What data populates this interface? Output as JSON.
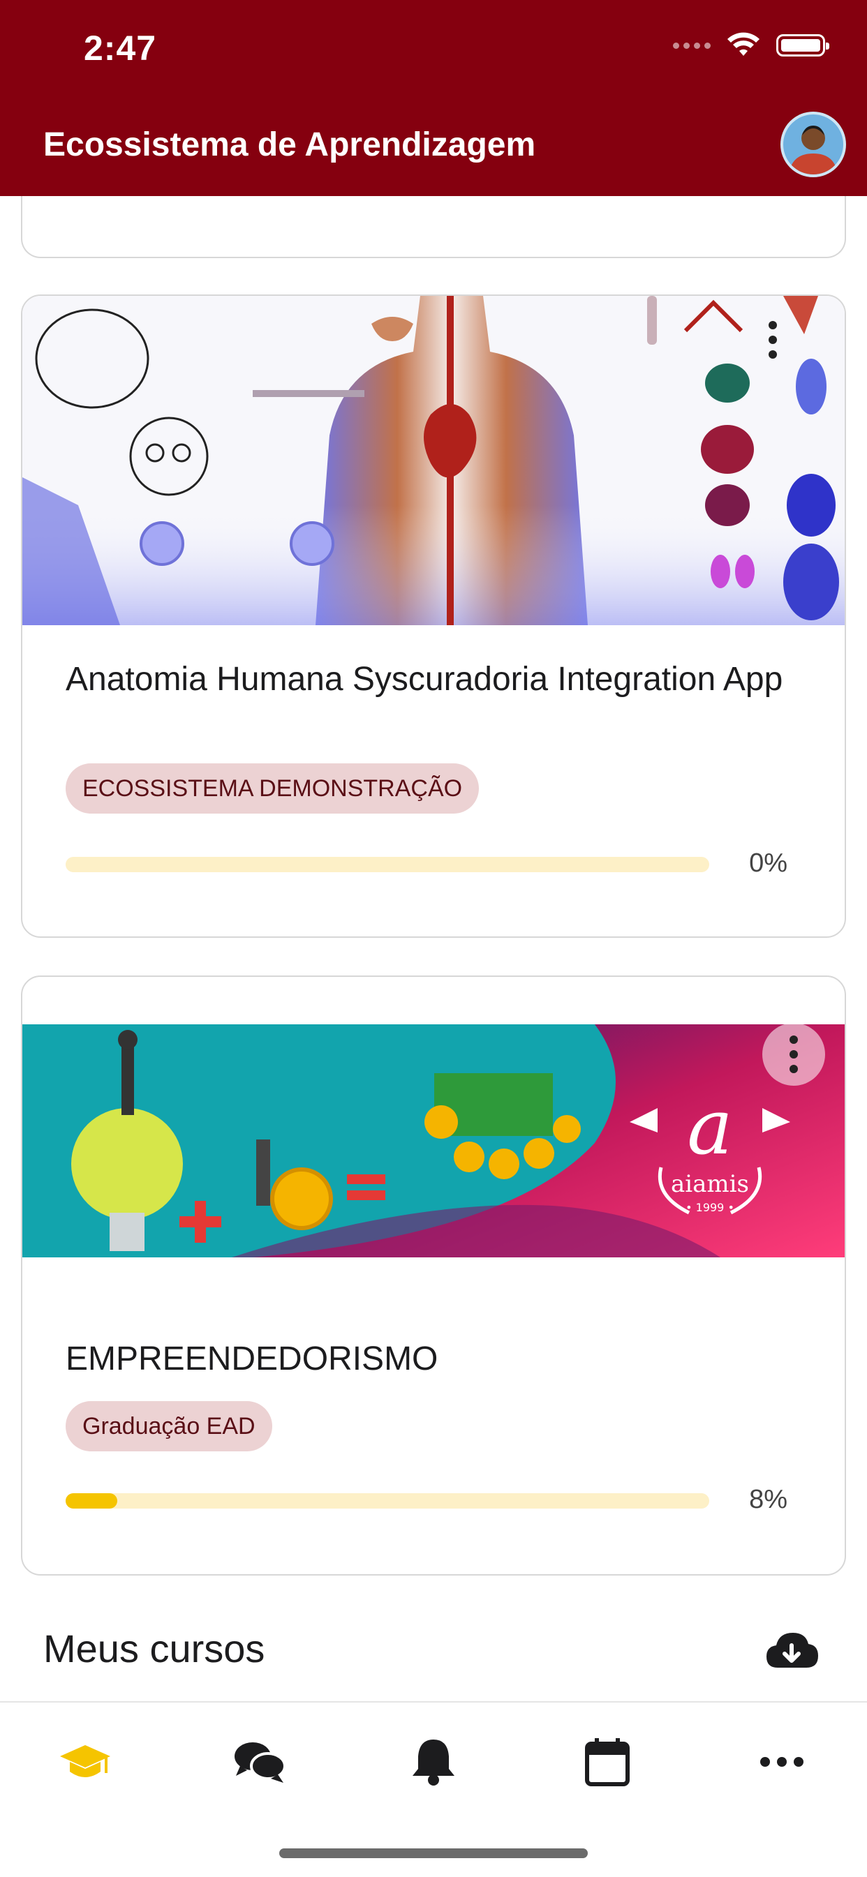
{
  "status_bar": {
    "time": "2:47"
  },
  "header": {
    "title": "Ecossistema de Aprendizagem",
    "avatar_icon": "user-avatar"
  },
  "courses": [
    {
      "title": "Anatomia Humana Syscuradoria Integration App",
      "tag": "ECOSSISTEMA DEMONSTRAÇÃO",
      "progress": 0,
      "progress_label": "0%",
      "image": "anatomy-banner"
    },
    {
      "title": "EMPREENDEDORISMO",
      "tag": "Graduação EAD",
      "progress": 0.08,
      "progress_label": "8%",
      "image": "entrepreneurship-banner",
      "logo_text": "aiamis",
      "logo_year": "• 1999 •"
    }
  ],
  "section": {
    "title": "Meus cursos",
    "action_icon": "cloud-download-icon"
  },
  "tabbar": {
    "items": [
      {
        "icon": "graduation-cap-icon",
        "active": true
      },
      {
        "icon": "chat-bubbles-icon",
        "active": false
      },
      {
        "icon": "bell-icon",
        "active": false
      },
      {
        "icon": "calendar-icon",
        "active": false
      },
      {
        "icon": "more-horizontal-icon",
        "active": false
      }
    ]
  },
  "colors": {
    "brand": "#85000f",
    "tag_bg": "#ecd2d3",
    "progress_track": "#fdf0c7",
    "progress_fill": "#f5c400",
    "tab_active": "#f5c400"
  }
}
